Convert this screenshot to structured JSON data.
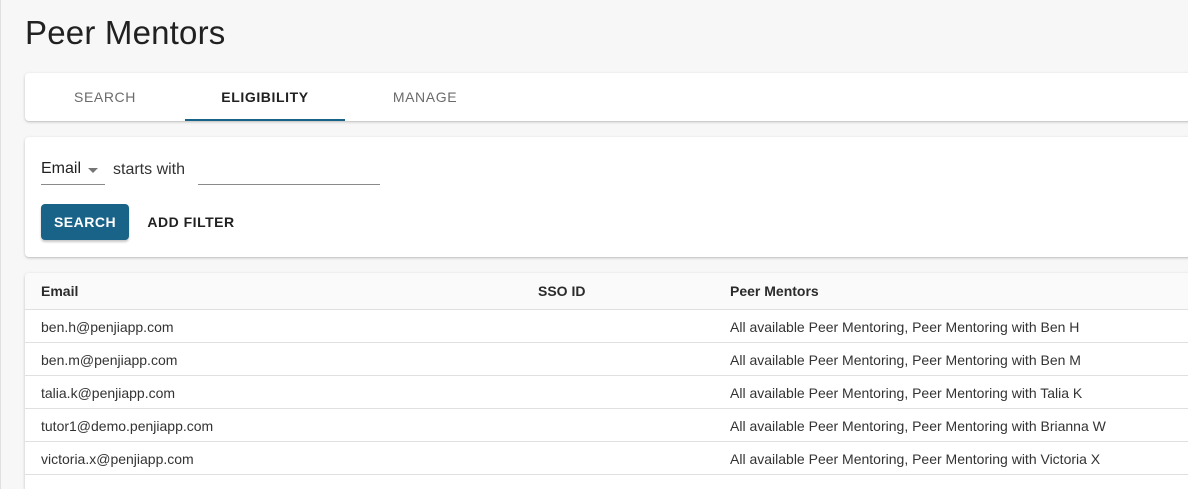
{
  "page": {
    "title": "Peer Mentors"
  },
  "tabs": [
    {
      "label": "SEARCH",
      "active": false
    },
    {
      "label": "ELIGIBILITY",
      "active": true
    },
    {
      "label": "MANAGE",
      "active": false
    }
  ],
  "filter": {
    "field_value": "Email",
    "operator": "starts with",
    "value": "",
    "search_label": "SEARCH",
    "add_filter_label": "ADD FILTER"
  },
  "table": {
    "columns": [
      "Email",
      "SSO ID",
      "Peer Mentors"
    ],
    "rows": [
      {
        "email": "ben.h@penjiapp.com",
        "sso_id": "",
        "peer_mentors": "All available Peer Mentoring, Peer Mentoring with Ben H"
      },
      {
        "email": "ben.m@penjiapp.com",
        "sso_id": "",
        "peer_mentors": "All available Peer Mentoring, Peer Mentoring with Ben M"
      },
      {
        "email": "talia.k@penjiapp.com",
        "sso_id": "",
        "peer_mentors": "All available Peer Mentoring, Peer Mentoring with Talia K"
      },
      {
        "email": "tutor1@demo.penjiapp.com",
        "sso_id": "",
        "peer_mentors": "All available Peer Mentoring, Peer Mentoring with Brianna W"
      },
      {
        "email": "victoria.x@penjiapp.com",
        "sso_id": "",
        "peer_mentors": "All available Peer Mentoring, Peer Mentoring with Victoria X"
      }
    ]
  },
  "colors": {
    "accent": "#1a6388",
    "divider": "#e0e0e0",
    "background": "#f7f7f7"
  },
  "icons": {
    "field_select_caret": "caret-down-icon"
  }
}
